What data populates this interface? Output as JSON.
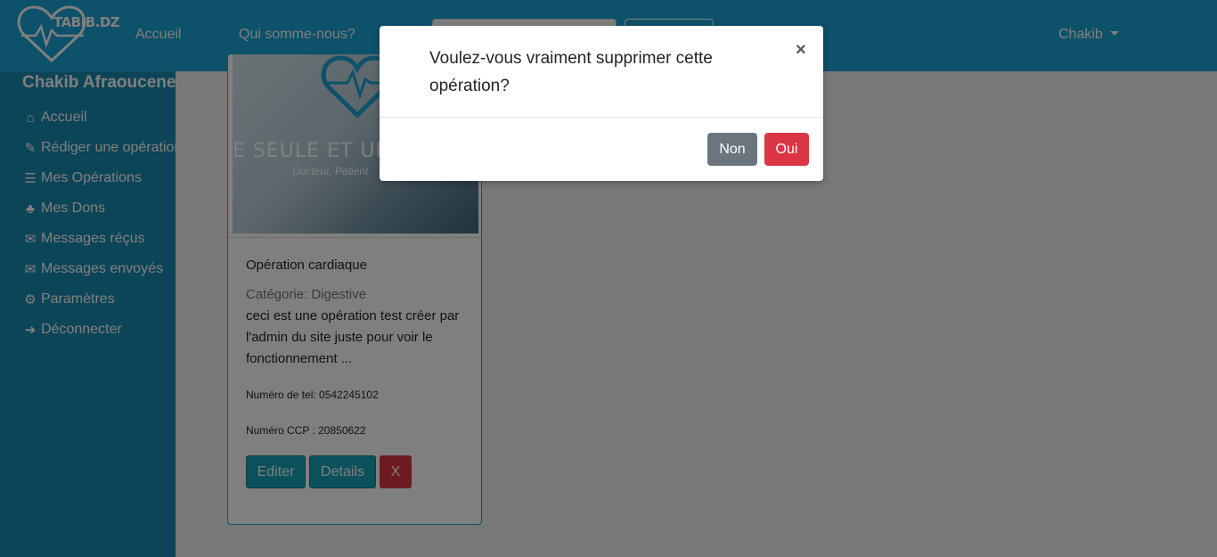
{
  "navbar": {
    "brand": "TABIB.DZ",
    "links": [
      "Accueil",
      "Qui somme-nous?"
    ],
    "user": "Chakib"
  },
  "sidebar": {
    "title": "Chakib Afraoucene",
    "items": [
      {
        "label": "Accueil",
        "icon": "home-icon"
      },
      {
        "label": "Rédiger une opération",
        "icon": "pen-icon"
      },
      {
        "label": "Mes Opérations",
        "icon": "list-icon"
      },
      {
        "label": "Mes Dons",
        "icon": "donate-icon"
      },
      {
        "label": "Messages réçus",
        "icon": "envelope-open-icon"
      },
      {
        "label": "Messages envoyés",
        "icon": "envelope-icon"
      },
      {
        "label": "Paramètres",
        "icon": "cogs-icon"
      },
      {
        "label": "Déconnecter",
        "icon": "sign-out-icon"
      }
    ]
  },
  "card": {
    "image_slogan": "E SEULE ET UNIQ",
    "image_sub": "Docteur, Patient",
    "title": "Opération cardiaque",
    "category": "Catégorie: Digestive",
    "description": "ceci est une opération test créer par l'admin du site juste pour voir le fonctionnement ...",
    "phone": "Numéro de tel: 0542245102",
    "ccp": "Numéro CCP : 20850622",
    "buttons": {
      "edit": "Editer",
      "details": "Details",
      "delete": "X"
    }
  },
  "modal": {
    "message": "Voulez-vous vraiment supprimer cette opération?",
    "close": "×",
    "no": "Non",
    "yes": "Oui"
  },
  "colors": {
    "navbar": "#1aa3d4",
    "sidebar": "#1a8bb0",
    "info": "#17a2b8",
    "danger": "#dc3545",
    "secondary": "#6c757d"
  }
}
